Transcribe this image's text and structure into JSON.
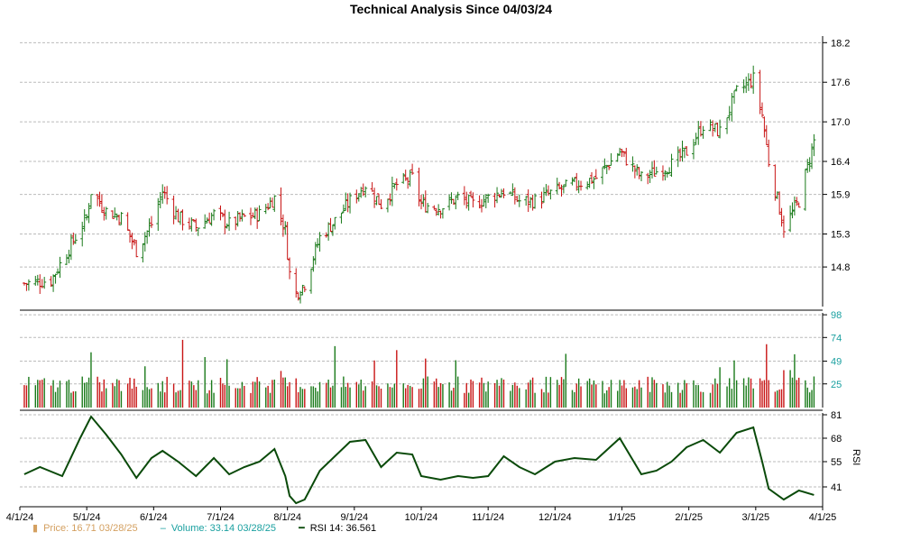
{
  "chart_data": {
    "type": "candlestick",
    "title": "Technical Analysis Since 04/03/24",
    "x_tick_labels": [
      "4/1/24",
      "5/1/24",
      "6/1/24",
      "7/1/24",
      "8/1/24",
      "9/1/24",
      "10/1/24",
      "11/1/24",
      "12/1/24",
      "1/1/25",
      "2/1/25",
      "3/1/25",
      "4/1/25"
    ],
    "price_panel": {
      "y_ticks": [
        "18.2",
        "17.6",
        "17.0",
        "16.4",
        "15.9",
        "15.3",
        "14.8"
      ],
      "ylim": [
        14.2,
        18.3
      ],
      "grid": true,
      "up_color": "#1a7a1a",
      "down_color": "#c81414",
      "series_name": "Price",
      "ohlc_points": [
        {
          "date": "4/3/24",
          "close": 14.55
        },
        {
          "date": "4/15/24",
          "close": 14.6
        },
        {
          "date": "4/25/24",
          "close": 15.2
        },
        {
          "date": "5/1/24",
          "close": 15.55
        },
        {
          "date": "5/3/24",
          "close": 15.95
        },
        {
          "date": "5/10/24",
          "close": 15.65
        },
        {
          "date": "5/17/24",
          "close": 15.55
        },
        {
          "date": "5/24/24",
          "close": 15.05
        },
        {
          "date": "5/31/24",
          "close": 15.45
        },
        {
          "date": "6/5/24",
          "close": 15.95
        },
        {
          "date": "6/12/24",
          "close": 15.55
        },
        {
          "date": "6/20/24",
          "close": 15.4
        },
        {
          "date": "6/28/24",
          "close": 15.6
        },
        {
          "date": "7/5/24",
          "close": 15.45
        },
        {
          "date": "7/12/24",
          "close": 15.55
        },
        {
          "date": "7/19/24",
          "close": 15.6
        },
        {
          "date": "7/26/24",
          "close": 15.85
        },
        {
          "date": "7/31/24",
          "close": 15.35
        },
        {
          "date": "8/2/24",
          "close": 14.7
        },
        {
          "date": "8/5/24",
          "close": 14.4
        },
        {
          "date": "8/9/24",
          "close": 14.55
        },
        {
          "date": "8/16/24",
          "close": 15.25
        },
        {
          "date": "8/23/24",
          "close": 15.5
        },
        {
          "date": "8/30/24",
          "close": 15.8
        },
        {
          "date": "9/6/24",
          "close": 16.05
        },
        {
          "date": "9/13/24",
          "close": 15.75
        },
        {
          "date": "9/20/24",
          "close": 16.05
        },
        {
          "date": "9/27/24",
          "close": 16.15
        },
        {
          "date": "10/1/24",
          "close": 15.75
        },
        {
          "date": "10/10/24",
          "close": 15.7
        },
        {
          "date": "10/18/24",
          "close": 15.85
        },
        {
          "date": "10/25/24",
          "close": 15.75
        },
        {
          "date": "11/1/24",
          "close": 15.85
        },
        {
          "date": "11/8/24",
          "close": 15.95
        },
        {
          "date": "11/15/24",
          "close": 15.8
        },
        {
          "date": "11/22/24",
          "close": 15.8
        },
        {
          "date": "12/1/24",
          "close": 15.95
        },
        {
          "date": "12/10/24",
          "close": 16.05
        },
        {
          "date": "12/20/24",
          "close": 16.15
        },
        {
          "date": "12/31/24",
          "close": 16.55
        },
        {
          "date": "1/10/25",
          "close": 16.15
        },
        {
          "date": "1/17/25",
          "close": 16.25
        },
        {
          "date": "1/24/25",
          "close": 16.35
        },
        {
          "date": "1/31/25",
          "close": 16.55
        },
        {
          "date": "2/7/25",
          "close": 16.95
        },
        {
          "date": "2/14/25",
          "close": 16.85
        },
        {
          "date": "2/21/25",
          "close": 17.45
        },
        {
          "date": "2/28/25",
          "close": 17.65
        },
        {
          "date": "3/4/25",
          "close": 17.1
        },
        {
          "date": "3/7/25",
          "close": 16.4
        },
        {
          "date": "3/14/25",
          "close": 15.4
        },
        {
          "date": "3/21/25",
          "close": 15.8
        },
        {
          "date": "3/28/25",
          "close": 16.71
        }
      ]
    },
    "volume_panel": {
      "y_ticks": [
        "98",
        "74",
        "49",
        "25"
      ],
      "ylim": [
        0,
        100
      ],
      "series_name": "Volume",
      "tick_color": "#1aa0a0"
    },
    "rsi_panel": {
      "y_ticks": [
        "81",
        "68",
        "55",
        "41"
      ],
      "ylim": [
        30,
        82
      ],
      "axis_label": "RSI",
      "series_name": "RSI 14",
      "line_color": "#0a4a0a",
      "points": [
        {
          "date": "4/3/24",
          "value": 48
        },
        {
          "date": "4/10/24",
          "value": 52
        },
        {
          "date": "4/20/24",
          "value": 47
        },
        {
          "date": "4/28/24",
          "value": 68
        },
        {
          "date": "5/3/24",
          "value": 80
        },
        {
          "date": "5/10/24",
          "value": 70
        },
        {
          "date": "5/17/24",
          "value": 59
        },
        {
          "date": "5/24/24",
          "value": 46
        },
        {
          "date": "5/31/24",
          "value": 57
        },
        {
          "date": "6/5/24",
          "value": 61
        },
        {
          "date": "6/12/24",
          "value": 55
        },
        {
          "date": "6/20/24",
          "value": 47
        },
        {
          "date": "6/28/24",
          "value": 57
        },
        {
          "date": "7/5/24",
          "value": 48
        },
        {
          "date": "7/12/24",
          "value": 52
        },
        {
          "date": "7/19/24",
          "value": 55
        },
        {
          "date": "7/26/24",
          "value": 62
        },
        {
          "date": "7/31/24",
          "value": 47
        },
        {
          "date": "8/2/24",
          "value": 36
        },
        {
          "date": "8/5/24",
          "value": 32
        },
        {
          "date": "8/9/24",
          "value": 34
        },
        {
          "date": "8/16/24",
          "value": 50
        },
        {
          "date": "8/23/24",
          "value": 58
        },
        {
          "date": "8/30/24",
          "value": 66
        },
        {
          "date": "9/6/24",
          "value": 67
        },
        {
          "date": "9/13/24",
          "value": 52
        },
        {
          "date": "9/20/24",
          "value": 60
        },
        {
          "date": "9/27/24",
          "value": 59
        },
        {
          "date": "10/1/24",
          "value": 47
        },
        {
          "date": "10/10/24",
          "value": 45
        },
        {
          "date": "10/18/24",
          "value": 47
        },
        {
          "date": "10/25/24",
          "value": 46
        },
        {
          "date": "11/1/24",
          "value": 47
        },
        {
          "date": "11/8/24",
          "value": 58
        },
        {
          "date": "11/15/24",
          "value": 52
        },
        {
          "date": "11/22/24",
          "value": 48
        },
        {
          "date": "12/1/24",
          "value": 55
        },
        {
          "date": "12/10/24",
          "value": 57
        },
        {
          "date": "12/20/24",
          "value": 56
        },
        {
          "date": "12/31/24",
          "value": 68
        },
        {
          "date": "1/10/25",
          "value": 48
        },
        {
          "date": "1/17/25",
          "value": 50
        },
        {
          "date": "1/24/25",
          "value": 55
        },
        {
          "date": "1/31/25",
          "value": 63
        },
        {
          "date": "2/7/25",
          "value": 67
        },
        {
          "date": "2/14/25",
          "value": 60
        },
        {
          "date": "2/21/25",
          "value": 71
        },
        {
          "date": "2/28/25",
          "value": 74
        },
        {
          "date": "3/4/25",
          "value": 55
        },
        {
          "date": "3/7/25",
          "value": 40
        },
        {
          "date": "3/14/25",
          "value": 34
        },
        {
          "date": "3/21/25",
          "value": 39
        },
        {
          "date": "3/28/25",
          "value": 36.561
        }
      ]
    },
    "legend": {
      "price": {
        "label": "Price: 16.71  03/28/25",
        "color": "#d4a060",
        "symbol": "▮"
      },
      "volume": {
        "label": "Volume: 33.14  03/28/25",
        "color": "#1aa0a0",
        "symbol": "–"
      },
      "rsi": {
        "label": "RSI 14: 36.561",
        "color": "#0a4a0a",
        "symbol": "━"
      }
    }
  }
}
